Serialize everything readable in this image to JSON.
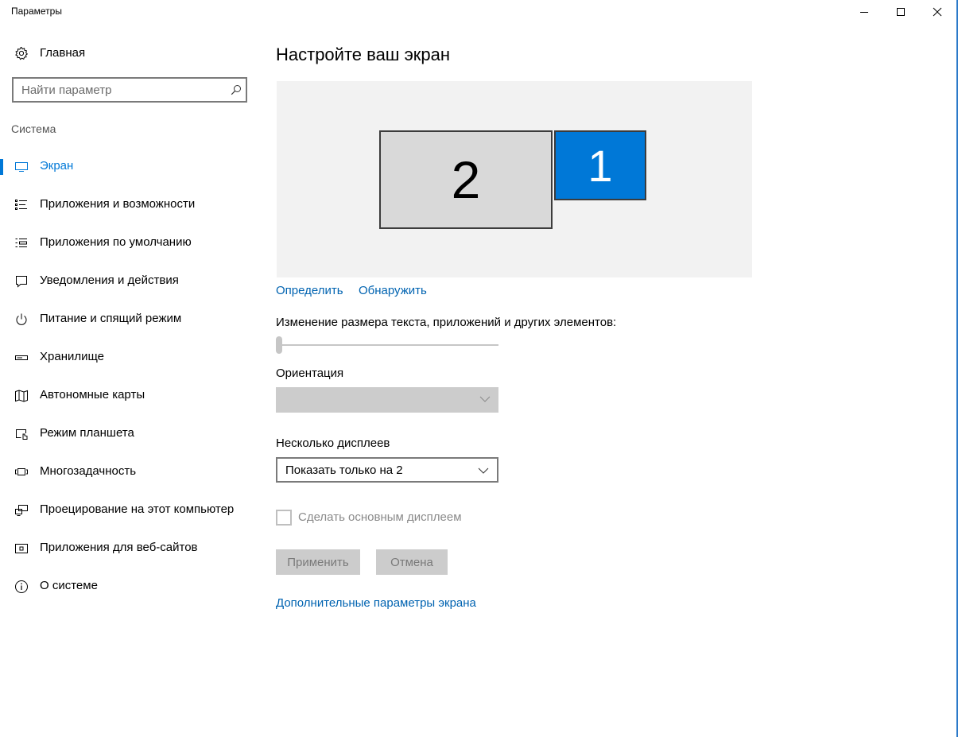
{
  "window": {
    "title": "Параметры",
    "controls": {
      "minimize": "minimize-icon",
      "maximize": "maximize-icon",
      "close": "close-icon"
    },
    "accent": "#0078d7",
    "border_color": "#2b79c9"
  },
  "sidebar": {
    "home_label": "Главная",
    "search_placeholder": "Найти параметр",
    "section_title": "Система",
    "items": [
      {
        "label": "Экран",
        "icon": "monitor-icon",
        "active": true
      },
      {
        "label": "Приложения и возможности",
        "icon": "apps-list-icon",
        "active": false
      },
      {
        "label": "Приложения по умолчанию",
        "icon": "default-apps-icon",
        "active": false
      },
      {
        "label": "Уведомления и действия",
        "icon": "notifications-icon",
        "active": false
      },
      {
        "label": "Питание и спящий режим",
        "icon": "power-icon",
        "active": false
      },
      {
        "label": "Хранилище",
        "icon": "storage-icon",
        "active": false
      },
      {
        "label": "Автономные карты",
        "icon": "map-icon",
        "active": false
      },
      {
        "label": "Режим планшета",
        "icon": "tablet-mode-icon",
        "active": false
      },
      {
        "label": "Многозадачность",
        "icon": "multitasking-icon",
        "active": false
      },
      {
        "label": "Проецирование на этот компьютер",
        "icon": "projecting-icon",
        "active": false
      },
      {
        "label": "Приложения для веб-сайтов",
        "icon": "web-apps-icon",
        "active": false
      },
      {
        "label": "О системе",
        "icon": "info-icon",
        "active": false
      }
    ]
  },
  "main": {
    "title": "Настройте ваш экран",
    "monitors": [
      {
        "number": "2",
        "selected": false
      },
      {
        "number": "1",
        "selected": true
      }
    ],
    "identify_link": "Определить",
    "detect_link": "Обнаружить",
    "scale_label": "Изменение размера текста, приложений и других элементов:",
    "scale_slider_value": 0,
    "orientation_label": "Ориентация",
    "orientation_value": "",
    "multi_display_label": "Несколько дисплеев",
    "multi_display_value": "Показать только на 2",
    "make_main_label": "Сделать основным дисплеем",
    "make_main_checked": false,
    "apply_button": "Применить",
    "cancel_button": "Отмена",
    "advanced_link": "Дополнительные параметры экрана",
    "link_color": "#0063b1"
  }
}
